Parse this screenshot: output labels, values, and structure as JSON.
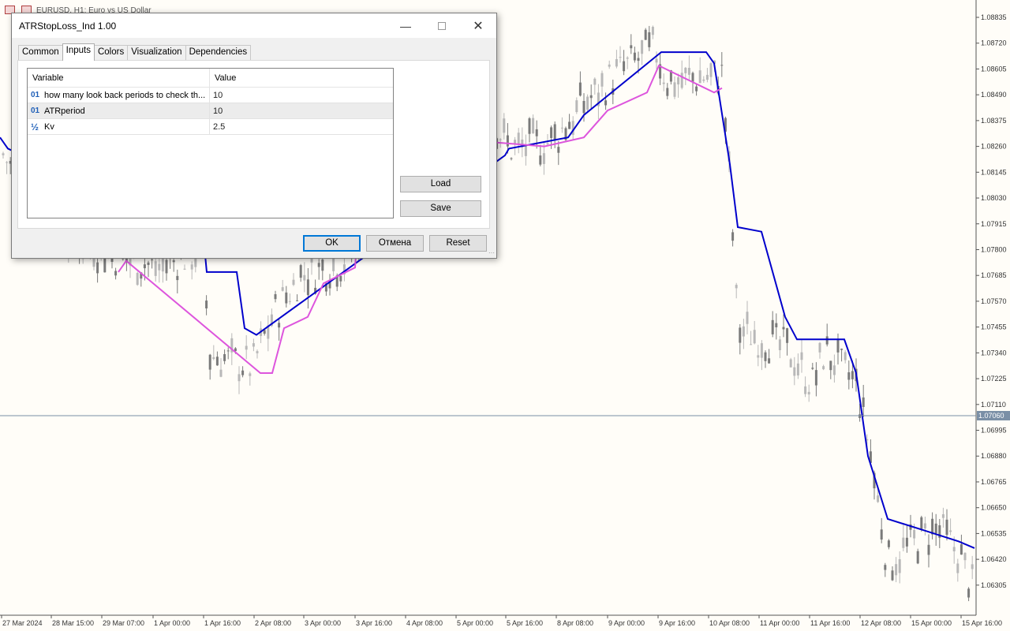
{
  "chart": {
    "title": "EURUSD, H1:  Euro vs US Dollar",
    "current_price": "1.07060",
    "price_axis": [
      "1.08835",
      "1.08720",
      "1.08605",
      "1.08490",
      "1.08375",
      "1.08260",
      "1.08145",
      "1.08030",
      "1.07915",
      "1.07800",
      "1.07685",
      "1.07570",
      "1.07455",
      "1.07340",
      "1.07225",
      "1.07110",
      "1.06995",
      "1.06880",
      "1.06765",
      "1.06650",
      "1.06535",
      "1.06420",
      "1.06305"
    ],
    "time_axis": [
      "27 Mar 2024",
      "28 Mar 15:00",
      "29 Mar 07:00",
      "1 Apr 00:00",
      "1 Apr 16:00",
      "2 Apr 08:00",
      "3 Apr 00:00",
      "3 Apr 16:00",
      "4 Apr 08:00",
      "5 Apr 00:00",
      "5 Apr 16:00",
      "8 Apr 08:00",
      "9 Apr 00:00",
      "9 Apr 16:00",
      "10 Apr 08:00",
      "11 Apr 00:00",
      "11 Apr 16:00",
      "12 Apr 08:00",
      "15 Apr 00:00",
      "15 Apr 16:00"
    ],
    "colors": {
      "background": "#fffdf8",
      "bull_candle": "#b8b8b8",
      "bear_candle": "#7a7a7a",
      "stop_upper": "#0000cc",
      "stop_lower": "#dd55dd",
      "price_line": "#7a8fa6",
      "price_tag": "#7a8fa6"
    }
  },
  "dialog": {
    "title": "ATRStopLoss_Ind 1.00",
    "window_controls": {
      "minimize": "minimize-icon",
      "maximize": "maximize-icon",
      "close": "close-icon"
    },
    "tabs": [
      {
        "label": "Common",
        "active": false
      },
      {
        "label": "Inputs",
        "active": true
      },
      {
        "label": "Colors",
        "active": false
      },
      {
        "label": "Visualization",
        "active": false
      },
      {
        "label": "Dependencies",
        "active": false
      }
    ],
    "grid": {
      "columns": [
        "Variable",
        "Value"
      ],
      "rows": [
        {
          "type_icon": "01",
          "variable": "how many look back periods to check th...",
          "value": "10"
        },
        {
          "type_icon": "01",
          "variable": "ATRperiod",
          "value": "10"
        },
        {
          "type_icon": "½",
          "variable": "Kv",
          "value": "2.5"
        }
      ]
    },
    "buttons": {
      "load": "Load",
      "save": "Save",
      "ok": "OK",
      "cancel": "Отмена",
      "reset": "Reset"
    }
  }
}
